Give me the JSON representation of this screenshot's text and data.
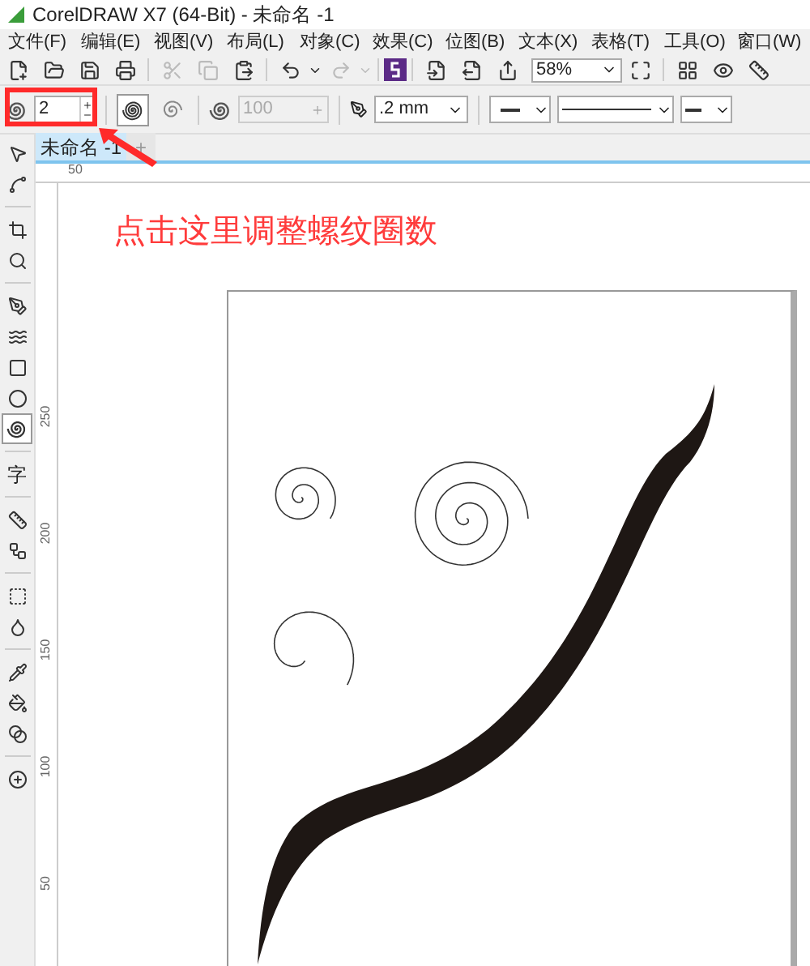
{
  "window": {
    "title": "CorelDRAW X7 (64-Bit) - 未命名 -1"
  },
  "menu": [
    "文件(F)",
    "编辑(E)",
    "视图(V)",
    "布局(L)",
    "对象(C)",
    "效果(C)",
    "位图(B)",
    "文本(X)",
    "表格(T)",
    "工具(O)",
    "窗口(W)"
  ],
  "toolbar": {
    "zoom": "58%"
  },
  "property_bar": {
    "revolutions": "2",
    "spiral_types": [
      {
        "selected": true
      },
      {
        "selected": false
      }
    ],
    "expansion": "100",
    "outline_width": ".2 mm"
  },
  "tabs": [
    {
      "label": "未命名 -1",
      "selected": true
    }
  ],
  "new_tab": "+",
  "rulers": {
    "horizontal": [
      "50"
    ],
    "vertical": [
      "250",
      "200",
      "150",
      "100",
      "50"
    ]
  },
  "toolbox": [
    {
      "selected": false
    },
    {
      "selected": false
    },
    {
      "selected": false
    },
    {
      "selected": false
    },
    {
      "selected": false
    },
    {
      "selected": false
    },
    {
      "selected": false
    },
    {
      "selected": false
    },
    {
      "selected": true
    },
    {
      "selected": false,
      "label": "字"
    },
    {
      "selected": false
    },
    {
      "selected": false
    },
    {
      "selected": false
    },
    {
      "selected": false
    },
    {
      "selected": false
    },
    {
      "selected": false
    },
    {
      "selected": false
    },
    {
      "selected": false
    }
  ],
  "annotation": {
    "text": "点击这里调整螺纹圈数"
  }
}
